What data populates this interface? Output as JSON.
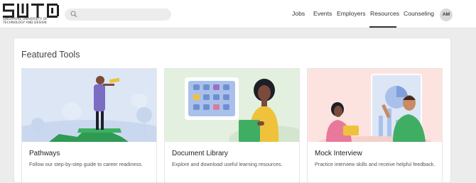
{
  "header": {
    "logo": {
      "wordmark": "SUTD",
      "subtitle_line1": "SINGAPORE UNIVERSITY OF",
      "subtitle_line2": "TECHNOLOGY AND DESIGN"
    },
    "search": {
      "placeholder": "",
      "value": "",
      "icon": "search-icon"
    },
    "nav": [
      {
        "label": "Jobs",
        "active": false
      },
      {
        "label": "Events",
        "active": false
      },
      {
        "label": "Employers",
        "active": false
      },
      {
        "label": "Resources",
        "active": true
      },
      {
        "label": "Counseling",
        "active": false
      }
    ],
    "avatar_initials": "AM"
  },
  "main": {
    "section_title": "Featured Tools",
    "cards": [
      {
        "title": "Pathways",
        "description": "Follow our step-by-step guide to career readiness.",
        "illustration": "person-with-telescope",
        "bg_color": "#dce6f5"
      },
      {
        "title": "Document Library",
        "description": "Explore and download useful learning resources.",
        "illustration": "woman-with-document-board",
        "bg_color": "#e3f0df"
      },
      {
        "title": "Mock Interview",
        "description": "Practice interview skills and receive helpful feedback.",
        "illustration": "interview-scene",
        "bg_color": "#fde3df"
      }
    ]
  }
}
